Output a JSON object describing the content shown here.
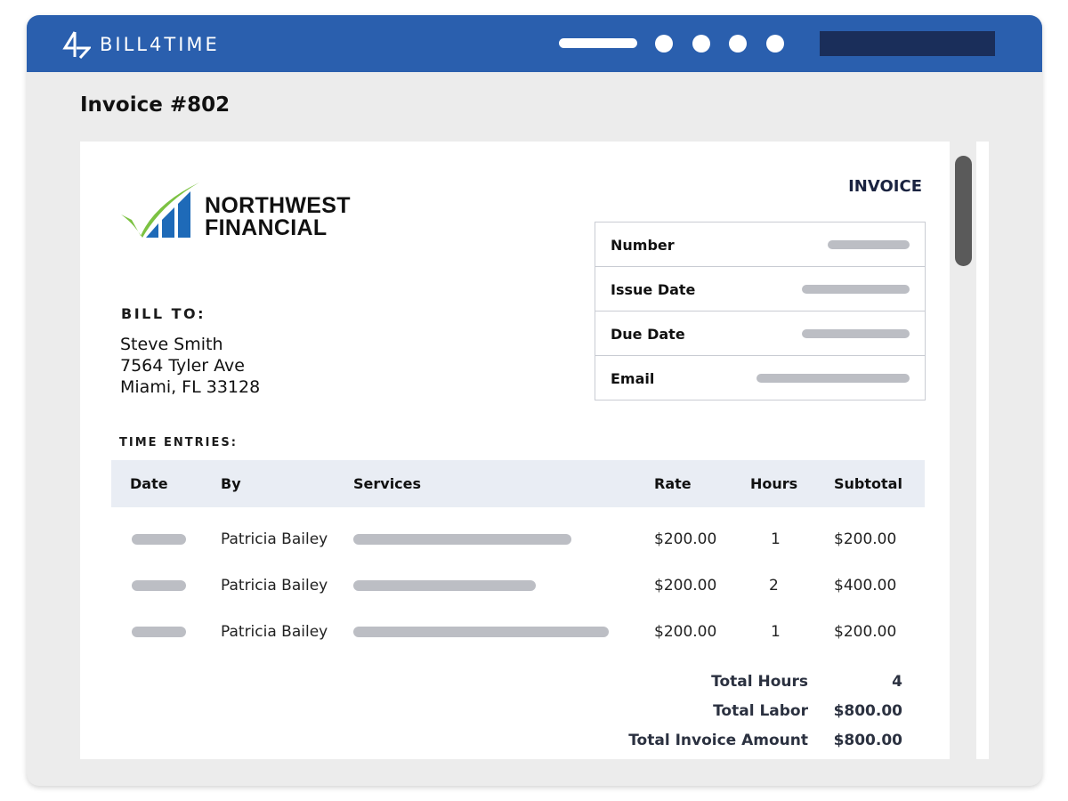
{
  "app": {
    "name": "BILL4TIME",
    "colors": {
      "header": "#2a5fae",
      "header_block": "#1a2e5a",
      "table_header": "#e9edf4",
      "placeholder": "#bcbec4"
    }
  },
  "page": {
    "title": "Invoice #802"
  },
  "invoice": {
    "heading": "INVOICE",
    "company": {
      "line1": "NORTHWEST",
      "line2": "FINANCIAL",
      "logo_icon": "checkmark-bars-logo"
    },
    "meta": [
      {
        "label": "Number"
      },
      {
        "label": "Issue Date"
      },
      {
        "label": "Due Date"
      },
      {
        "label": "Email"
      }
    ],
    "bill_to": {
      "label": "BILL TO:",
      "name": "Steve Smith",
      "street": "7564 Tyler Ave",
      "city": "Miami, FL 33128"
    },
    "time_entries": {
      "label": "TIME ENTRIES:",
      "columns": [
        "Date",
        "By",
        "Services",
        "Rate",
        "Hours",
        "Subtotal"
      ],
      "rows": [
        {
          "by": "Patricia Bailey",
          "rate": "$200.00",
          "hours": "1",
          "subtotal": "$200.00"
        },
        {
          "by": "Patricia Bailey",
          "rate": "$200.00",
          "hours": "2",
          "subtotal": "$400.00"
        },
        {
          "by": "Patricia Bailey",
          "rate": "$200.00",
          "hours": "1",
          "subtotal": "$200.00"
        }
      ]
    },
    "totals": [
      {
        "label": "Total Hours",
        "value": "4"
      },
      {
        "label": "Total Labor",
        "value": "$800.00"
      },
      {
        "label": "Total Invoice Amount",
        "value": "$800.00"
      }
    ]
  }
}
